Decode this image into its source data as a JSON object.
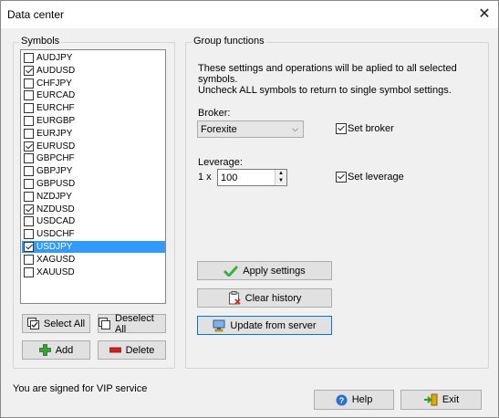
{
  "window": {
    "title": "Data center",
    "close_glyph": "✕"
  },
  "symbols": {
    "legend": "Symbols",
    "items": [
      {
        "label": "AUDJPY",
        "checked": false,
        "selected": false
      },
      {
        "label": "AUDUSD",
        "checked": true,
        "selected": false
      },
      {
        "label": "CHFJPY",
        "checked": false,
        "selected": false
      },
      {
        "label": "EURCAD",
        "checked": false,
        "selected": false
      },
      {
        "label": "EURCHF",
        "checked": false,
        "selected": false
      },
      {
        "label": "EURGBP",
        "checked": false,
        "selected": false
      },
      {
        "label": "EURJPY",
        "checked": false,
        "selected": false
      },
      {
        "label": "EURUSD",
        "checked": true,
        "selected": false
      },
      {
        "label": "GBPCHF",
        "checked": false,
        "selected": false
      },
      {
        "label": "GBPJPY",
        "checked": false,
        "selected": false
      },
      {
        "label": "GBPUSD",
        "checked": false,
        "selected": false
      },
      {
        "label": "NZDJPY",
        "checked": false,
        "selected": false
      },
      {
        "label": "NZDUSD",
        "checked": true,
        "selected": false
      },
      {
        "label": "USDCAD",
        "checked": false,
        "selected": false
      },
      {
        "label": "USDCHF",
        "checked": false,
        "selected": false
      },
      {
        "label": "USDJPY",
        "checked": true,
        "selected": true
      },
      {
        "label": "XAGUSD",
        "checked": false,
        "selected": false
      },
      {
        "label": "XAUUSD",
        "checked": false,
        "selected": false
      }
    ],
    "select_all_label": "Select All",
    "deselect_all_label": "Deselect All",
    "add_label": "Add",
    "delete_label": "Delete"
  },
  "group": {
    "legend": "Group functions",
    "description_line1": "These settings and operations will be aplied to all selected symbols.",
    "description_line2": "Uncheck ALL symbols to return to single symbol settings.",
    "broker_label": "Broker:",
    "broker_value": "Forexite",
    "set_broker_label": "Set broker",
    "set_broker_checked": true,
    "leverage_label": "Leverage:",
    "leverage_prefix": "1 x",
    "leverage_value": "100",
    "set_leverage_label": "Set leverage",
    "set_leverage_checked": true,
    "apply_label": "Apply settings",
    "clear_label": "Clear history",
    "update_label": "Update from server"
  },
  "footer": {
    "status_text": "You are signed for VIP service",
    "help_label": "Help",
    "exit_label": "Exit"
  },
  "colors": {
    "selection": "#3399ff",
    "accent_focus": "#0078d7",
    "add_icon": "#3aa23a",
    "delete_icon": "#d42020",
    "help_icon": "#2a6fd6"
  }
}
